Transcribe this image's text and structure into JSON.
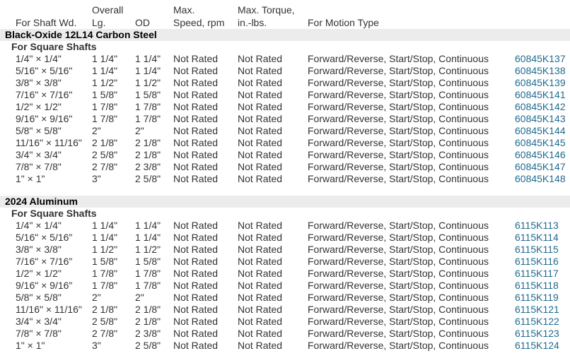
{
  "headers": {
    "shaft_wd": "For Shaft Wd.",
    "overall_line1": "Overall",
    "overall_line2": "Lg.",
    "od": "OD",
    "speed_line1": "Max.",
    "speed_line2": "Speed, rpm",
    "torque_line1": "Max. Torque,",
    "torque_line2": "in.-lbs.",
    "motion": "For Motion Type"
  },
  "sections": [
    {
      "title": "Black-Oxide 12L14 Carbon Steel",
      "subtitle": "For Square Shafts",
      "rows": [
        {
          "size": "1/4\" × 1/4\"",
          "length": "1 1/4\"",
          "od": "1 1/4\"",
          "speed": "Not Rated",
          "torque": "Not Rated",
          "motion": "Forward/Reverse, Start/Stop, Continuous",
          "part": "60845K137"
        },
        {
          "size": "5/16\" × 5/16\"",
          "length": "1 1/4\"",
          "od": "1 1/4\"",
          "speed": "Not Rated",
          "torque": "Not Rated",
          "motion": "Forward/Reverse, Start/Stop, Continuous",
          "part": "60845K138"
        },
        {
          "size": "3/8\" × 3/8\"",
          "length": "1 1/2\"",
          "od": "1 1/2\"",
          "speed": "Not Rated",
          "torque": "Not Rated",
          "motion": "Forward/Reverse, Start/Stop, Continuous",
          "part": "60845K139"
        },
        {
          "size": "7/16\" × 7/16\"",
          "length": "1 5/8\"",
          "od": "1 5/8\"",
          "speed": "Not Rated",
          "torque": "Not Rated",
          "motion": "Forward/Reverse, Start/Stop, Continuous",
          "part": "60845K141"
        },
        {
          "size": "1/2\" × 1/2\"",
          "length": "1 7/8\"",
          "od": "1 7/8\"",
          "speed": "Not Rated",
          "torque": "Not Rated",
          "motion": "Forward/Reverse, Start/Stop, Continuous",
          "part": "60845K142"
        },
        {
          "size": "9/16\" × 9/16\"",
          "length": "1 7/8\"",
          "od": "1 7/8\"",
          "speed": "Not Rated",
          "torque": "Not Rated",
          "motion": "Forward/Reverse, Start/Stop, Continuous",
          "part": "60845K143"
        },
        {
          "size": "5/8\" × 5/8\"",
          "length": "2\"",
          "od": "2\"",
          "speed": "Not Rated",
          "torque": "Not Rated",
          "motion": "Forward/Reverse, Start/Stop, Continuous",
          "part": "60845K144"
        },
        {
          "size": "11/16\" × 11/16\"",
          "length": "2 1/8\"",
          "od": "2 1/8\"",
          "speed": "Not Rated",
          "torque": "Not Rated",
          "motion": "Forward/Reverse, Start/Stop, Continuous",
          "part": "60845K145"
        },
        {
          "size": "3/4\" × 3/4\"",
          "length": "2 5/8\"",
          "od": "2 1/8\"",
          "speed": "Not Rated",
          "torque": "Not Rated",
          "motion": "Forward/Reverse, Start/Stop, Continuous",
          "part": "60845K146"
        },
        {
          "size": "7/8\" × 7/8\"",
          "length": "2 7/8\"",
          "od": "2 3/8\"",
          "speed": "Not Rated",
          "torque": "Not Rated",
          "motion": "Forward/Reverse, Start/Stop, Continuous",
          "part": "60845K147"
        },
        {
          "size": "1\" × 1\"",
          "length": "3\"",
          "od": "2 5/8\"",
          "speed": "Not Rated",
          "torque": "Not Rated",
          "motion": "Forward/Reverse, Start/Stop, Continuous",
          "part": "60845K148"
        }
      ]
    },
    {
      "title": "2024 Aluminum",
      "subtitle": "For Square Shafts",
      "rows": [
        {
          "size": "1/4\" × 1/4\"",
          "length": "1 1/4\"",
          "od": "1 1/4\"",
          "speed": "Not Rated",
          "torque": "Not Rated",
          "motion": "Forward/Reverse, Start/Stop, Continuous",
          "part": "6115K113"
        },
        {
          "size": "5/16\" × 5/16\"",
          "length": "1 1/4\"",
          "od": "1 1/4\"",
          "speed": "Not Rated",
          "torque": "Not Rated",
          "motion": "Forward/Reverse, Start/Stop, Continuous",
          "part": "6115K114"
        },
        {
          "size": "3/8\" × 3/8\"",
          "length": "1 1/2\"",
          "od": "1 1/2\"",
          "speed": "Not Rated",
          "torque": "Not Rated",
          "motion": "Forward/Reverse, Start/Stop, Continuous",
          "part": "6115K115"
        },
        {
          "size": "7/16\" × 7/16\"",
          "length": "1 5/8\"",
          "od": "1 5/8\"",
          "speed": "Not Rated",
          "torque": "Not Rated",
          "motion": "Forward/Reverse, Start/Stop, Continuous",
          "part": "6115K116"
        },
        {
          "size": "1/2\" × 1/2\"",
          "length": "1 7/8\"",
          "od": "1 7/8\"",
          "speed": "Not Rated",
          "torque": "Not Rated",
          "motion": "Forward/Reverse, Start/Stop, Continuous",
          "part": "6115K117"
        },
        {
          "size": "9/16\" × 9/16\"",
          "length": "1 7/8\"",
          "od": "1 7/8\"",
          "speed": "Not Rated",
          "torque": "Not Rated",
          "motion": "Forward/Reverse, Start/Stop, Continuous",
          "part": "6115K118"
        },
        {
          "size": "5/8\" × 5/8\"",
          "length": "2\"",
          "od": "2\"",
          "speed": "Not Rated",
          "torque": "Not Rated",
          "motion": "Forward/Reverse, Start/Stop, Continuous",
          "part": "6115K119"
        },
        {
          "size": "11/16\" × 11/16\"",
          "length": "2 1/8\"",
          "od": "2 1/8\"",
          "speed": "Not Rated",
          "torque": "Not Rated",
          "motion": "Forward/Reverse, Start/Stop, Continuous",
          "part": "6115K121"
        },
        {
          "size": "3/4\" × 3/4\"",
          "length": "2 5/8\"",
          "od": "2 1/8\"",
          "speed": "Not Rated",
          "torque": "Not Rated",
          "motion": "Forward/Reverse, Start/Stop, Continuous",
          "part": "6115K122"
        },
        {
          "size": "7/8\" × 7/8\"",
          "length": "2 7/8\"",
          "od": "2 3/8\"",
          "speed": "Not Rated",
          "torque": "Not Rated",
          "motion": "Forward/Reverse, Start/Stop, Continuous",
          "part": "6115K123"
        },
        {
          "size": "1\" × 1\"",
          "length": "3\"",
          "od": "2 5/8\"",
          "speed": "Not Rated",
          "torque": "Not Rated",
          "motion": "Forward/Reverse, Start/Stop, Continuous",
          "part": "6115K124"
        }
      ]
    }
  ],
  "colors": {
    "text": "#333333",
    "section_bg": "#ececec",
    "link": "#1f6b8e"
  }
}
